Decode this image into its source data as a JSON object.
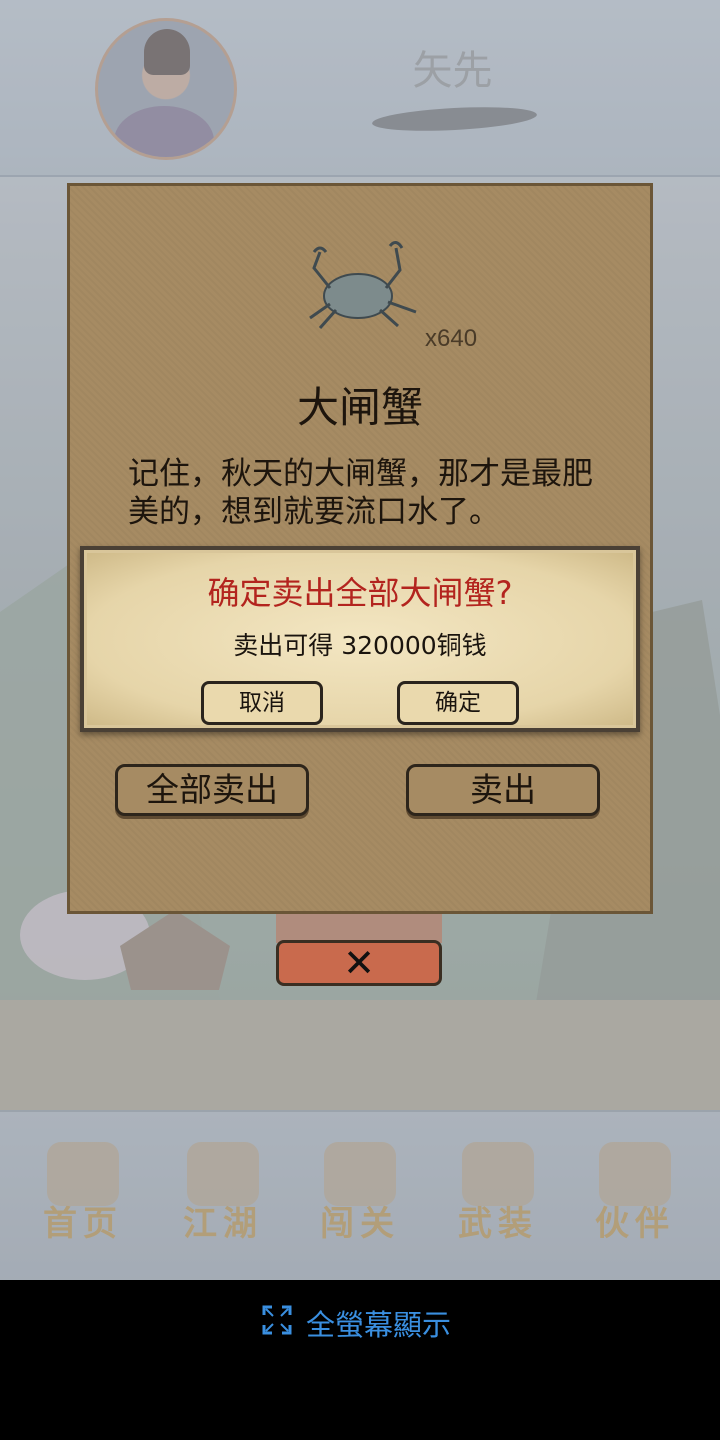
{
  "header": {
    "player_name": "矢先"
  },
  "item_dialog": {
    "item_icon": "crab-icon",
    "count": "x640",
    "item_name": "大闸蟹",
    "description": "记住，秋天的大闸蟹，那才是最肥美的，想到就要流口水了。",
    "sell_all_label": "全部卖出",
    "sell_label": "卖出"
  },
  "confirm_dialog": {
    "title": "确定卖出全部大闸蟹?",
    "message": "卖出可得 320000铜钱",
    "cancel_label": "取消",
    "ok_label": "确定"
  },
  "close_button": {
    "icon": "close-icon"
  },
  "nav": {
    "items": [
      {
        "label": "首页",
        "icon": "home-icon"
      },
      {
        "label": "江湖",
        "icon": "scroll-icon"
      },
      {
        "label": "闯关",
        "icon": "swords-icon"
      },
      {
        "label": "武装",
        "icon": "armor-icon"
      },
      {
        "label": "伙伴",
        "icon": "partners-icon"
      }
    ]
  },
  "fullscreen": {
    "label": "全螢幕顯示",
    "icon": "fullscreen-icon"
  },
  "colors": {
    "dialog_bg": "#a68b63",
    "confirm_title": "#b3241e",
    "fullscreen_text": "#3a8fe0",
    "close_button": "#c96a4d"
  }
}
